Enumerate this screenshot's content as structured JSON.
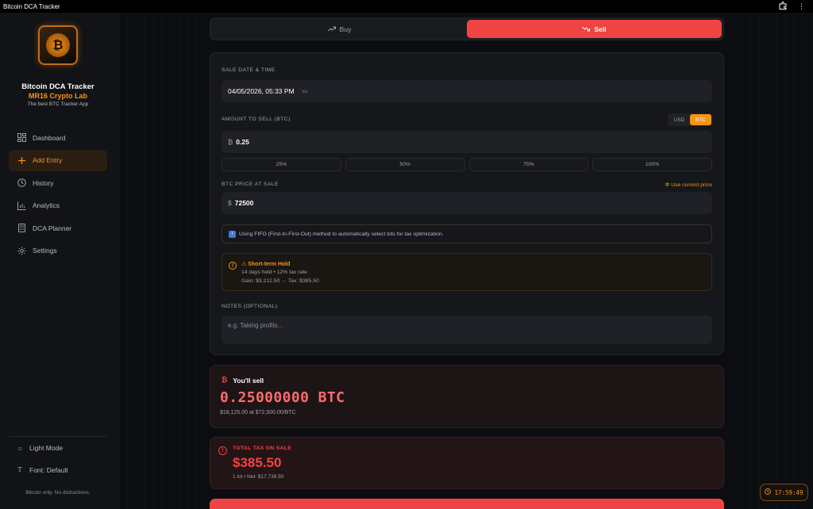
{
  "window": {
    "title": "Bitcoin DCA Tracker"
  },
  "brand": {
    "name": "Bitcoin DCA Tracker",
    "org": "MR16 Crypto Lab",
    "tagline": "The best BTC Tracker App"
  },
  "nav": [
    {
      "label": "Dashboard",
      "icon": "dashboard-icon"
    },
    {
      "label": "Add Entry",
      "icon": "plus-icon",
      "active": true
    },
    {
      "label": "History",
      "icon": "clock-icon"
    },
    {
      "label": "Analytics",
      "icon": "bar-chart-icon"
    },
    {
      "label": "DCA Planner",
      "icon": "calculator-icon"
    },
    {
      "label": "Settings",
      "icon": "gear-icon"
    }
  ],
  "footer": {
    "light_mode": "Light Mode",
    "font": "Font: Default",
    "note": "Bitcoin only. No distractions."
  },
  "tabs": {
    "buy": "Buy",
    "sell": "Sell",
    "selected": "Sell"
  },
  "form": {
    "date_label": "SALE DATE & TIME",
    "date_value": "04/05/2026, 05:33 PM",
    "amount_label": "AMOUNT TO SELL (BTC)",
    "units": [
      "USD",
      "BTC"
    ],
    "unit_selected": "BTC",
    "amount_prefix": "₿",
    "amount_value": "0.25",
    "percent_options": [
      "25%",
      "50%",
      "75%",
      "100%"
    ],
    "price_label": "BTC PRICE AT SALE",
    "use_current_price": "Use current price",
    "price_prefix": "$",
    "price_value": "72500",
    "fifo_info": "Using FIFO (First-In-First-Out) method to automatically select lots for tax optimization.",
    "hold_title": "⚠ Short-term Hold",
    "hold_line1": "14 days held • 12% tax rate",
    "hold_line2": "Gain: $3,212.50 → Tax: $385.50",
    "notes_label": "NOTES (OPTIONAL)",
    "notes_placeholder": "e.g. Taking profits..."
  },
  "summary": {
    "heading": "You'll sell",
    "amount": "0.25000000 BTC",
    "detail": "$18,125.00 at $72,500.00/BTC"
  },
  "tax": {
    "label": "TOTAL TAX ON SALE",
    "value": "$385.50",
    "detail": "1 lot • Net: $17,739.50"
  },
  "clock": {
    "time": "17:59:49"
  },
  "colors": {
    "accent_orange": "#f7931a",
    "sell_red": "#f04444"
  }
}
